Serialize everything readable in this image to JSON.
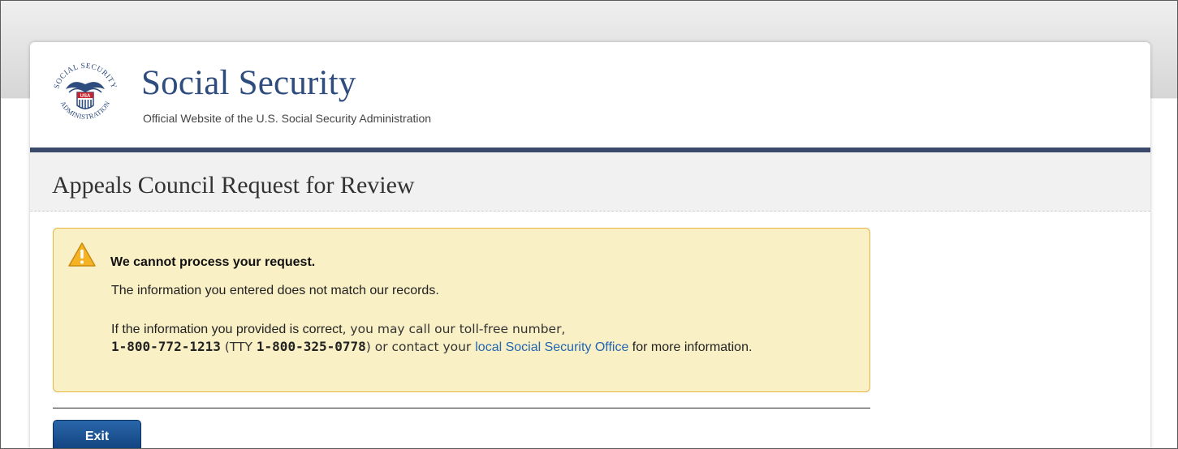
{
  "header": {
    "seal_top_text": "SOCIAL SECURITY",
    "seal_bottom_text": "ADMINISTRATION",
    "seal_center_text": "USA",
    "brand_title": "Social Security",
    "brand_subtitle": "Official Website of the U.S. Social Security Administration"
  },
  "page": {
    "title": "Appeals Council Request for Review"
  },
  "alert": {
    "icon": "warning-icon",
    "heading": "We cannot process your request.",
    "line1": "The information you entered does not match our records.",
    "para_part1": "If the information you provided is correct",
    "para_part2": ", you may call our toll-free number,",
    "phone": "1-800-772-1213",
    "tty_open": " (TTY ",
    "tty_phone": "1-800-325-0778",
    "tty_close": ") or contact your ",
    "link_text": "local Social Security Office",
    "para_end": " for more information.",
    "colors": {
      "background": "#faf0c6",
      "border": "#e5b73e"
    }
  },
  "actions": {
    "exit_label": "Exit"
  },
  "colors": {
    "brand": "#2f4c7e",
    "navbar": "#3b4a6b",
    "button": "#1a4f93",
    "link": "#2265b4"
  }
}
